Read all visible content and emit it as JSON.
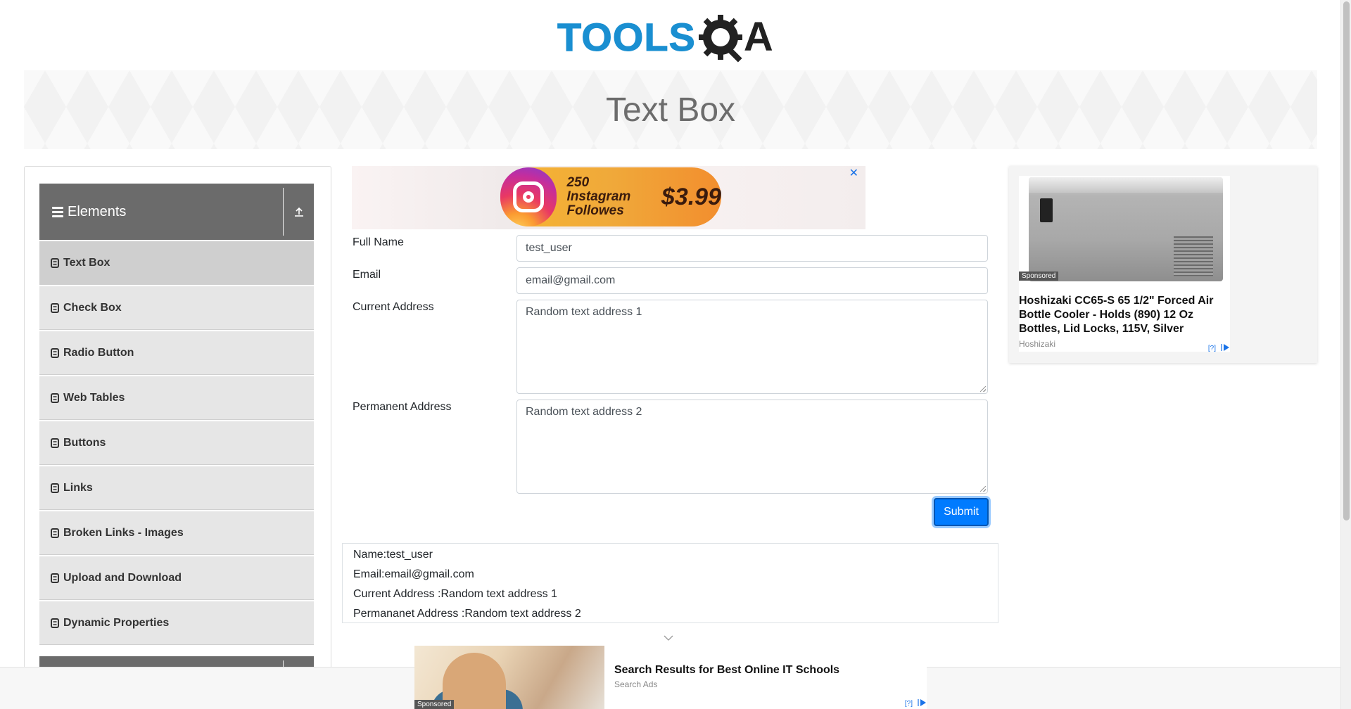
{
  "header": {
    "logo_text": "TOOLS",
    "logo_suffix": "A"
  },
  "banner": {
    "title": "Text Box"
  },
  "sidebar": {
    "group_title": "Elements",
    "items": [
      {
        "label": "Text Box",
        "active": true
      },
      {
        "label": "Check Box"
      },
      {
        "label": "Radio Button"
      },
      {
        "label": "Web Tables"
      },
      {
        "label": "Buttons"
      },
      {
        "label": "Links"
      },
      {
        "label": "Broken Links - Images"
      },
      {
        "label": "Upload and Download"
      },
      {
        "label": "Dynamic Properties"
      }
    ]
  },
  "ad_top": {
    "line1": "250 Instagram",
    "line2": "Followes",
    "price": "$3.99",
    "close": "✕"
  },
  "form": {
    "full_name_label": "Full Name",
    "full_name_value": "test_user",
    "email_label": "Email",
    "email_value": "email@gmail.com",
    "current_address_label": "Current Address",
    "current_address_value": "Random text address 1",
    "permanent_address_label": "Permanent Address",
    "permanent_address_value": "Random text address 2",
    "submit_label": "Submit"
  },
  "output": {
    "name": "Name:test_user",
    "email": "Email:email@gmail.com",
    "current_address": "Current Address :Random text address 1",
    "permanent_address": "Permananet Address :Random text address 2"
  },
  "ad_right": {
    "sponsored": "Sponsored",
    "title": "Hoshizaki CC65-S 65 1/2\" Forced Air Bottle Cooler - Holds (890) 12 Oz Bottles, Lid Locks, 115V, Silver",
    "source": "Hoshizaki",
    "info": "[?]"
  },
  "ad_bottom": {
    "sponsored": "Sponsored",
    "title": "Search Results for Best Online IT Schools",
    "source": "Search Ads",
    "info": "[?]"
  },
  "colors": {
    "primary": "#007bff",
    "sidebar_header": "#6b6b6b",
    "logo_blue": "#1a8fd1"
  }
}
